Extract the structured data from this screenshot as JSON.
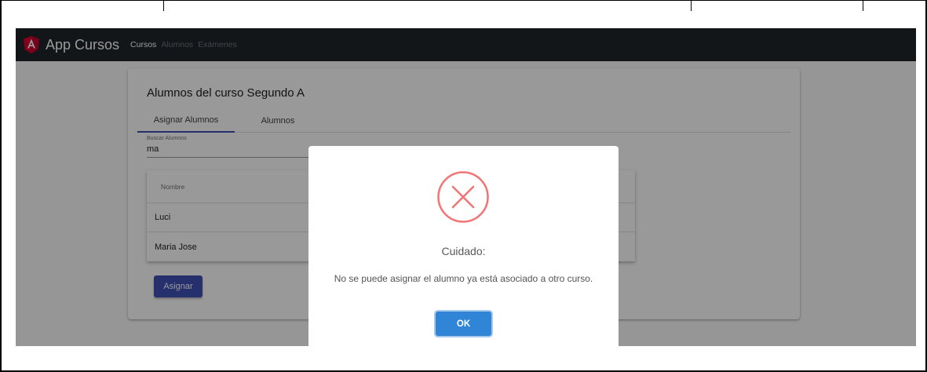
{
  "navbar": {
    "brand": "App Cursos",
    "links": [
      {
        "label": "Cursos",
        "active": true
      },
      {
        "label": "Alumnos",
        "active": false
      },
      {
        "label": "Exámenes",
        "active": false
      }
    ]
  },
  "card": {
    "title": "Alumnos del curso Segundo A",
    "tabs": [
      "Asignar Alumnos",
      "Alumnos"
    ],
    "search": {
      "label": "Buscar Alumnos",
      "value": "ma"
    },
    "table": {
      "header": "Nombre",
      "rows": [
        "Luci",
        "Maria Jose"
      ]
    },
    "assign_button": "Asignar"
  },
  "dialog": {
    "icon": "error-x-icon",
    "title": "Cuidado:",
    "text": "No se puede asignar el alumno ya está asociado a otro curso.",
    "ok_button": "OK"
  },
  "colors": {
    "navbar": "#212529",
    "primary": "#3f51b5",
    "error": "#f27474",
    "confirm": "#3085d6"
  }
}
